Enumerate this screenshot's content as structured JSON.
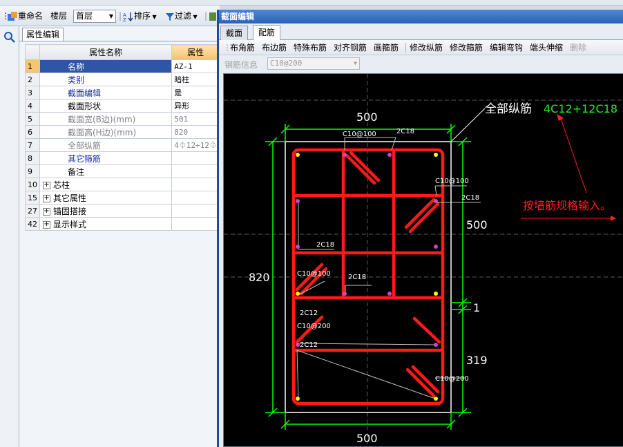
{
  "toolbar": {
    "rename": "重命名",
    "floor_label": "楼层",
    "floor_value": "首层",
    "sort": "排序",
    "filter": "过滤"
  },
  "props_panel": {
    "tab": "属性编辑",
    "col_name": "属性名称",
    "col_value": "属性",
    "rows": [
      {
        "num": "1",
        "name": "名称",
        "value": "AZ-1"
      },
      {
        "num": "2",
        "name": "类别",
        "value": "暗柱"
      },
      {
        "num": "3",
        "name": "截面编辑",
        "value": "是"
      },
      {
        "num": "4",
        "name": "截面形状",
        "value": "异形"
      },
      {
        "num": "5",
        "name": "截面宽(B边)(mm)",
        "value": "501"
      },
      {
        "num": "6",
        "name": "截面高(H边)(mm)",
        "value": "820"
      },
      {
        "num": "7",
        "name": "全部纵筋",
        "value": "4⏀12+12⏀"
      },
      {
        "num": "8",
        "name": "其它箍筋",
        "value": ""
      },
      {
        "num": "9",
        "name": "备注",
        "value": ""
      },
      {
        "num": "10",
        "name": "芯柱",
        "value": ""
      },
      {
        "num": "15",
        "name": "其它属性",
        "value": ""
      },
      {
        "num": "27",
        "name": "锚固搭接",
        "value": ""
      },
      {
        "num": "42",
        "name": "显示样式",
        "value": ""
      }
    ]
  },
  "dialog": {
    "title": "截面编辑",
    "tabs": [
      "截面",
      "配筋"
    ],
    "tools": [
      "布角筋",
      "布边筋",
      "特殊布筋",
      "对齐钢筋",
      "画箍筋",
      "修改纵筋",
      "修改箍筋",
      "编辑弯钩",
      "端头伸缩",
      "删除"
    ],
    "info_label": "钢筋信息",
    "info_value": "C10@200"
  },
  "drawing": {
    "dim_top": "500",
    "dim_bottom": "500",
    "dim_left": "820",
    "dim_right_1": "500",
    "dim_right_2": "1",
    "dim_right_3": "319",
    "all_long_label": "全部纵筋",
    "all_long_value": "4C12+12C18",
    "note": "按墙筋规格输入。",
    "labels": [
      "C10@100",
      "2C18",
      "C10@100",
      "2C18",
      "2C18",
      "C10@100",
      "2C18",
      "2C12",
      "C10@200",
      "2C12",
      "C10@200"
    ]
  },
  "colors": {
    "rebar": "#ff1a1a",
    "dimension": "#00ff00",
    "note": "#ff2020",
    "title_bar": "#2a62b8",
    "selected_row": "#2f56a6"
  }
}
